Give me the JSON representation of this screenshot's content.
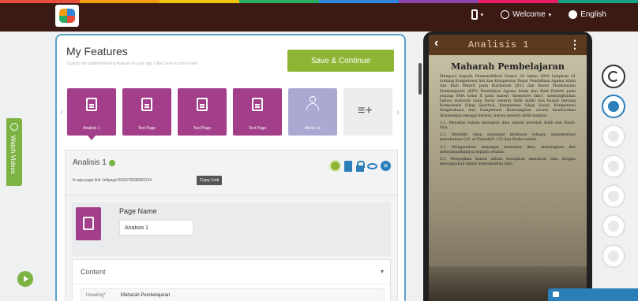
{
  "header": {
    "stripe_colors": [
      "#e74c3c",
      "#f39c12",
      "#f1c40f",
      "#27ae60",
      "#2e86de",
      "#8e44ad",
      "#e91e63",
      "#16a085"
    ],
    "device_caret": "▾",
    "welcome": "Welcome",
    "welcome_caret": "▾",
    "language": "English"
  },
  "sidebar": {
    "watch_videos": "Watch Videos"
  },
  "features": {
    "title": "My Features",
    "subtitle": "(Specify the added following features to your app. Click Save to lock it now)",
    "save_button": "Save & Continue",
    "pages": [
      {
        "label": "Analisis 1",
        "type": "text",
        "selected": true
      },
      {
        "label": "Text Page",
        "type": "text"
      },
      {
        "label": "Text Page",
        "type": "text"
      },
      {
        "label": "Text Page",
        "type": "text"
      },
      {
        "label": "About Us",
        "type": "person"
      }
    ],
    "add_page_icon": "≡+"
  },
  "editor": {
    "title": "Analisis 1",
    "link_text": "In app page link: feifpage153637363898231#",
    "copy_link": "Copy Link",
    "page_name_label": "Page Name",
    "page_name_value": "Analisis 1",
    "content_label": "Content",
    "content_chevron": "▾",
    "heading_label": "Heading*",
    "heading_value": "Maharah Pembelajaran"
  },
  "phone": {
    "back": "‹",
    "title": "Analisis 1",
    "menu": "⋮",
    "heading": "Maharah Pembelajaran",
    "paragraph": "Mengacu kepada Permendikbud Nomor 24 tahun 2016 lampiran 41 tentang Kompetensi Inti dan Kompetensi Dasar Pendidikan Agama Islam dan Budi Pekerti pada Kurikulum 2013 dan Revisi Pelaksanaan Pembelajaran (RPP) Pendidikan Agama Islam dan Budi Pekerti pada jenjang SMA kelas X pada materi \"memotret ilmu\", memungkinkan bahwa maharah yang harus peserta didik miliki dan kuasai tentang Kompetensi Sikap Spiritual, Kompetensi Sikap Sosial, Kompetensi Pengetahuan dan Kompetensi Keterampilan secara keseluruhan dirumuskan sebagai berikut, bahwa peserta didik mampu:",
    "items": [
      "1.1. Meyakini bahwa menuntut ilmu adalah perintah Allah dan Rasul-Nya.",
      "2.1. Memiliki sikap semangat keilmuan sebagai implementasi pemahaman Q.S. at-Taubah/9: 122 dan Hadis terkait.",
      "3.1. Menganalisis semangat menuntut ilmu, menerapkan dan menyampaikannya kepada sesama.",
      "4.1. Menyajikan kaitan antara kewajiban menuntut ilmu dengan kesungguhan dalam menyebarkan ilmu."
    ]
  },
  "devices": [
    "refresh-icon",
    "android-icon",
    "apple-icon",
    "windows-icon",
    "blackberry-icon",
    "amazon-icon",
    "desktop-icon"
  ],
  "chat": {
    "label": "—"
  }
}
